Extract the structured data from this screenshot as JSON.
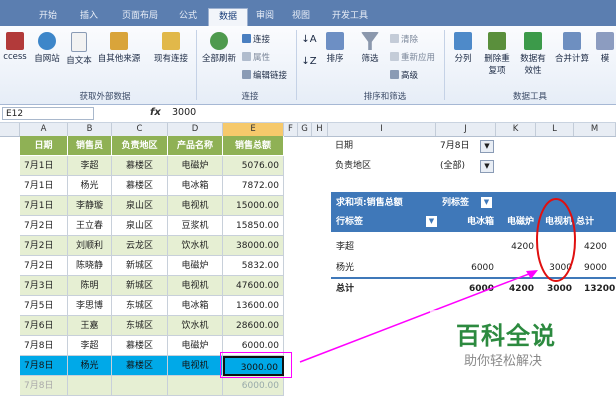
{
  "ribbon_tabs": [
    "开始",
    "插入",
    "页面布局",
    "公式",
    "数据",
    "审阅",
    "视图",
    "开发工具"
  ],
  "active_tab": "数据",
  "ribbon": {
    "get_external": [
      "ccess",
      "自网站",
      "自文本",
      "自其他来源",
      "现有连接"
    ],
    "get_external_label": "获取外部数据",
    "refresh_all": "全部刷新",
    "conn_items": [
      "连接",
      "属性",
      "编辑链接"
    ],
    "conn_label": "连接",
    "sort_items": [
      "排序",
      "筛选"
    ],
    "filter_items": [
      "清除",
      "重新应用",
      "高级"
    ],
    "sort_label": "排序和筛选",
    "tools": [
      "分列",
      "删除重复项",
      "数据有效性",
      "合并计算",
      "模"
    ],
    "tools_label": "数据工具"
  },
  "formula_bar": {
    "name_box": "E12",
    "fx": "fx",
    "value": "3000"
  },
  "columns": [
    "A",
    "B",
    "C",
    "D",
    "E",
    "F",
    "G",
    "H",
    "I",
    "J",
    "K",
    "L",
    "M"
  ],
  "table": {
    "headers": [
      "日期",
      "销售员",
      "负责地区",
      "产品名称",
      "销售总额"
    ],
    "rows": [
      [
        "7月1日",
        "李超",
        "慕楼区",
        "电磁炉",
        "5076.00"
      ],
      [
        "7月1日",
        "杨光",
        "慕楼区",
        "电冰箱",
        "7872.00"
      ],
      [
        "7月1日",
        "李静璇",
        "泉山区",
        "电视机",
        "15000.00"
      ],
      [
        "7月2日",
        "王立春",
        "泉山区",
        "豆浆机",
        "15850.00"
      ],
      [
        "7月2日",
        "刘顺利",
        "云龙区",
        "饮水机",
        "38000.00"
      ],
      [
        "7月2日",
        "陈晓静",
        "新城区",
        "电磁炉",
        "5832.00"
      ],
      [
        "7月3日",
        "陈明",
        "新城区",
        "电视机",
        "47600.00"
      ],
      [
        "7月5日",
        "李思博",
        "东城区",
        "电冰箱",
        "13600.00"
      ],
      [
        "7月6日",
        "王嘉",
        "东城区",
        "饮水机",
        "28600.00"
      ],
      [
        "7月8日",
        "李超",
        "慕楼区",
        "电磁炉",
        "6000.00"
      ],
      [
        "7月8日",
        "杨光",
        "慕楼区",
        "电视机",
        "3000.00"
      ],
      [
        "7月8日",
        "",
        "",
        "",
        "6000.00"
      ]
    ]
  },
  "pivot": {
    "filter1_label": "日期",
    "filter1_value": "7月8日",
    "filter2_label": "负责地区",
    "filter2_value": "(全部)",
    "values_label": "求和项:销售总额",
    "col_labels": "列标签",
    "row_labels": "行标签",
    "col_headers": [
      "电冰箱",
      "电磁炉",
      "电视机",
      "总计"
    ],
    "rows": [
      {
        "name": "李超",
        "values": [
          "",
          "4200",
          "",
          "4200"
        ]
      },
      {
        "name": "杨光",
        "values": [
          "6000",
          "",
          "3000",
          "9000"
        ]
      }
    ],
    "total": {
      "name": "总计",
      "values": [
        "6000",
        "4200",
        "3000",
        "13200"
      ]
    }
  },
  "watermark": {
    "title": "百科全说",
    "subtitle": "助你轻松解决"
  },
  "colors": {
    "ribbon_tab_bar": "#5b7eb0",
    "table_header": "#8fb155",
    "pivot_header": "#3f78b9",
    "selection": "#00a9e8",
    "annotation": "#ff00ff",
    "circle": "#e01010"
  }
}
